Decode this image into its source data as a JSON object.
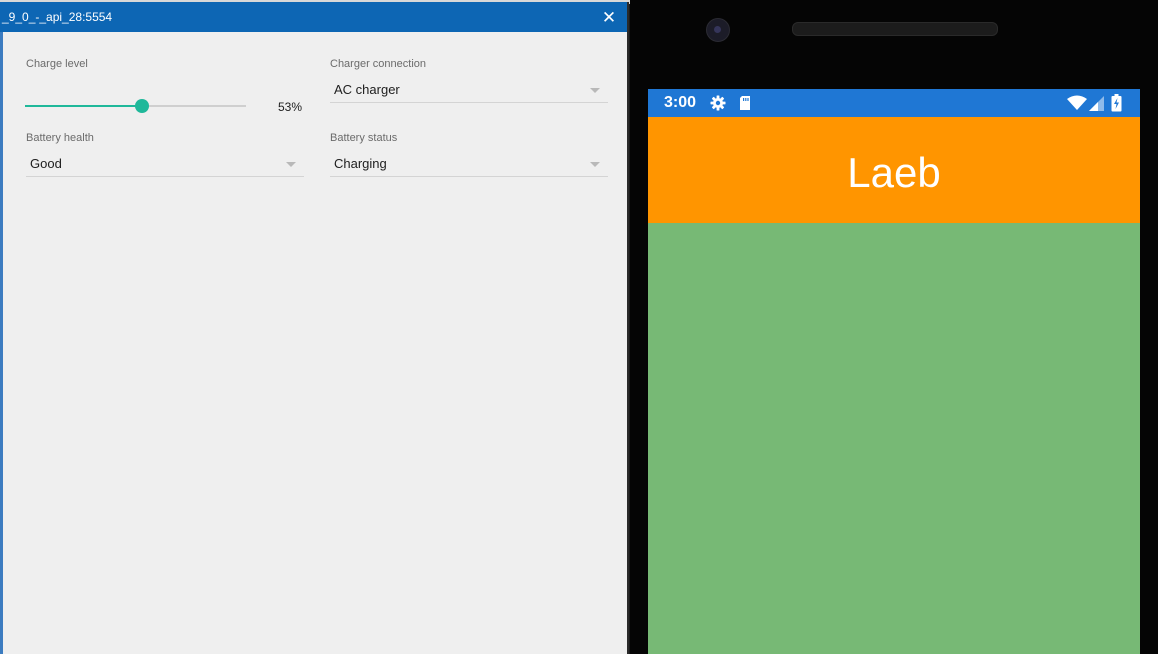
{
  "window": {
    "title": "_9_0_-_api_28:5554",
    "close_glyph": "✕"
  },
  "battery": {
    "charge_level": {
      "label": "Charge level",
      "value_text": "53%",
      "value": 0.53
    },
    "charger_connection": {
      "label": "Charger connection",
      "value": "AC charger"
    },
    "battery_health": {
      "label": "Battery health",
      "value": "Good"
    },
    "battery_status": {
      "label": "Battery status",
      "value": "Charging"
    }
  },
  "phone": {
    "status_bar": {
      "time": "3:00",
      "icons": [
        "settings-icon",
        "sd-card-icon",
        "wifi-icon",
        "cell-signal-icon",
        "battery-charging-icon"
      ]
    },
    "app_title": "Laeb"
  },
  "colors": {
    "titlebar": "#0d66b4",
    "slider_accent": "#1fb89a",
    "status_bar": "#1f77d4",
    "app_bar": "#ff9500",
    "content": "#77b975"
  }
}
